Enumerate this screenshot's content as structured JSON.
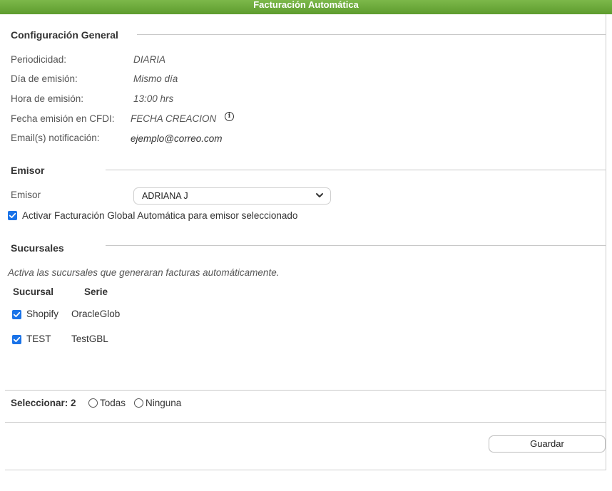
{
  "window": {
    "title": "Facturación Automática"
  },
  "config": {
    "heading": "Configuración General",
    "rows": [
      {
        "label": "Periodicidad:",
        "value": "DIARIA"
      },
      {
        "label": "Día de emisión:",
        "value": "Mismo día"
      },
      {
        "label": "Hora de emisión:",
        "value": "13:00 hrs"
      },
      {
        "label": "Fecha emisión en CFDI:",
        "value": "FECHA CREACION"
      },
      {
        "label": "Email(s) notificación:",
        "value": "ejemplo@correo.com"
      }
    ],
    "info_icon": "info-circle-icon"
  },
  "emisor": {
    "heading": "Emisor",
    "label": "Emisor",
    "selected": "ADRIANA J",
    "checkbox_label": "Activar Facturación Global Automática para emisor seleccionado",
    "checkbox_checked": true
  },
  "sucursales": {
    "heading": "Sucursales",
    "hint": "Activa las sucursales que generaran facturas automáticamente.",
    "columns": [
      "Sucursal",
      "Serie"
    ],
    "rows": [
      {
        "sucursal": "Shopify",
        "serie": "OracleGlob",
        "checked": true
      },
      {
        "sucursal": "TEST",
        "serie": "TestGBL",
        "checked": true
      }
    ]
  },
  "footer": {
    "select_label": "Seleccionar: 2",
    "option_all": "Todas",
    "option_none": "Ninguna",
    "save_label": "Guardar"
  },
  "colors": {
    "titlebar": "#6aab3a",
    "checkbox": "#1a73e8"
  }
}
